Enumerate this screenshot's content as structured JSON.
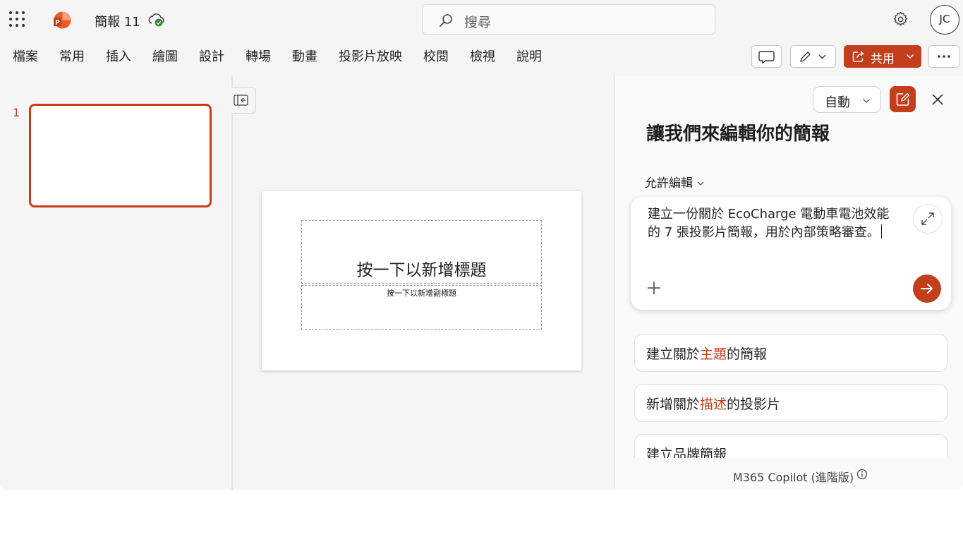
{
  "titlebar": {
    "doc_title": "簡報 11",
    "search_placeholder": "搜尋",
    "user_initials": "JC"
  },
  "ribbon": {
    "tabs": [
      "檔案",
      "常用",
      "插入",
      "繪圖",
      "設計",
      "轉場",
      "動畫",
      "投影片放映",
      "校閱",
      "檢視",
      "說明"
    ],
    "share_label": "共用"
  },
  "thumbnails": {
    "slide_number": "1"
  },
  "slide": {
    "title_placeholder": "按一下以新增標題",
    "subtitle_placeholder": "按一下以新增副標題"
  },
  "copilot": {
    "mode_label": "自動",
    "heading": "讓我們來編輯你的簡報",
    "allow_edit_label": "允許編輯",
    "prompt_text": "建立一份關於 EcoCharge 電動車電池效能的 7 張投影片簡報，用於內部策略審查。",
    "suggestions": [
      {
        "before": "建立關於",
        "highlight": "主題",
        "after": "的簡報"
      },
      {
        "before": "新增關於",
        "highlight": "描述",
        "after": "的投影片"
      },
      {
        "before": "建立品牌簡報",
        "highlight": "",
        "after": ""
      }
    ],
    "footer": "M365 Copilot (進階版)"
  },
  "colors": {
    "accent": "#c43e1c",
    "background": "#f5f5f5",
    "pane": "#fafafa"
  },
  "icons": [
    "waffle-icon",
    "powerpoint-logo-icon",
    "cloud-sync-icon",
    "search-icon",
    "gear-icon",
    "comment-icon",
    "pencil-icon",
    "share-icon",
    "more-icon",
    "collapse-pane-icon",
    "chevron-down-icon",
    "new-chat-icon",
    "close-icon",
    "expand-icon",
    "plus-icon",
    "send-arrow-icon",
    "info-icon"
  ]
}
